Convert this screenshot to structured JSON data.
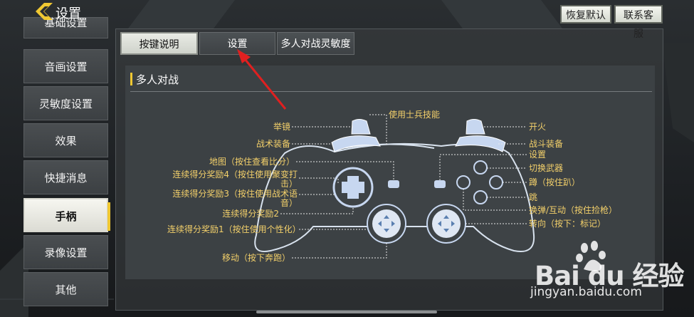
{
  "header": {
    "title": "设置",
    "restore_default": "恢复默认",
    "contact_support": "联系客服"
  },
  "sidebar": {
    "items": [
      {
        "label": "基础设置"
      },
      {
        "label": "音画设置"
      },
      {
        "label": "灵敏度设置"
      },
      {
        "label": "效果"
      },
      {
        "label": "快捷消息"
      },
      {
        "label": "手柄",
        "active": true
      },
      {
        "label": "录像设置"
      },
      {
        "label": "其他"
      }
    ]
  },
  "tabs": [
    {
      "label": "按键说明",
      "active": true
    },
    {
      "label": "设置"
    },
    {
      "label": "多人对战灵敏度"
    }
  ],
  "section": {
    "title": "多人对战"
  },
  "controller": {
    "left_labels": [
      "举镜",
      "战术装备",
      "地图（按住查看比分）",
      "连续得分奖励4（按住使用聚变打击）",
      "连续得分奖励3（按住使用战术语音）",
      "连续得分奖励2",
      "连续得分奖励1（按住使用个性化）",
      "移动（按下奔跑）"
    ],
    "top_label": "使用士兵技能",
    "right_labels": [
      "开火",
      "战斗装备",
      "设置",
      "切换武器",
      "蹲（按住趴）",
      "跳",
      "换弹/互动（按住捡枪）",
      "转向（按下：标记）"
    ]
  },
  "watermark": {
    "brand": "Bai du 经验",
    "url": "jingyan.baidu.com"
  },
  "colors": {
    "accent": "#f0c832",
    "label": "#f3d06a",
    "annotation_arrow": "#e02020"
  }
}
